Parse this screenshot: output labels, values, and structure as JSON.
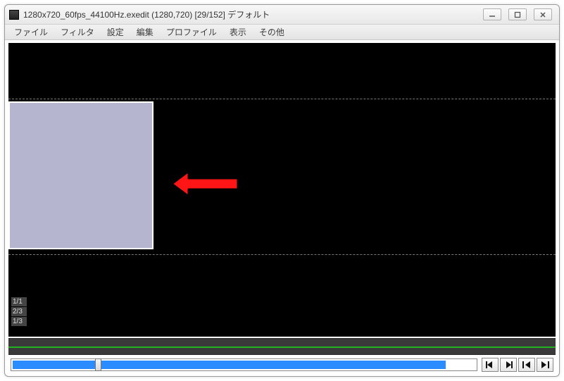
{
  "window": {
    "title": "1280x720_60fps_44100Hz.exedit (1280,720)  [29/152]  デフォルト"
  },
  "menu": {
    "items": [
      "ファイル",
      "フィルタ",
      "設定",
      "編集",
      "プロファイル",
      "表示",
      "その他"
    ]
  },
  "preview": {
    "indicators": [
      "1/1",
      "2/3",
      "1/3"
    ]
  },
  "seek": {
    "fill_percent": 93,
    "handle_percent": 18
  }
}
